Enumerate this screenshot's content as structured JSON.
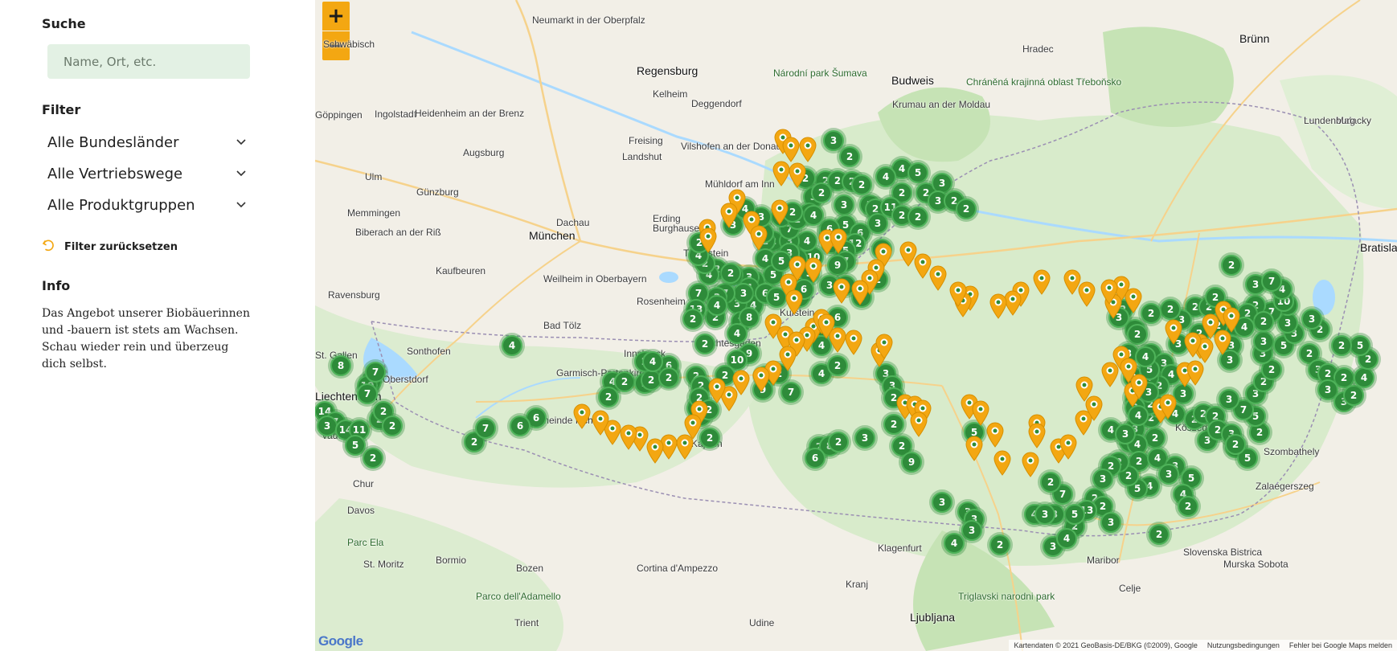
{
  "sidebar": {
    "search": {
      "heading": "Suche",
      "placeholder": "Name, Ort, etc."
    },
    "filter": {
      "heading": "Filter",
      "selects": [
        {
          "label": "Alle Bundesländer"
        },
        {
          "label": "Alle Vertriebswege"
        },
        {
          "label": "Alle Produktgruppen"
        }
      ],
      "reset_label": "Filter zurücksetzen"
    },
    "info": {
      "heading": "Info",
      "text": "Das Angebot unserer Biobäuerinnen und -bauern ist stets am Wachsen. Schau wieder rein und überzeug dich selbst."
    }
  },
  "map": {
    "zoom_in": "+",
    "zoom_out": "−",
    "google_logo": "Google",
    "attribution": {
      "data": "Kartendaten © 2021 GeoBasis-DE/BKG (©2009), Google",
      "terms": "Nutzungsbedingungen",
      "report": "Fehler bei Google Maps melden"
    },
    "colors": {
      "cluster": "#2e8b3a",
      "pin": "#f3a712",
      "land": "#f2efe7",
      "forest": "#cfe8c2",
      "water": "#aadaff"
    },
    "places": [
      {
        "name": "Brünn",
        "kind": "city"
      },
      {
        "name": "Regensburg",
        "kind": "city"
      },
      {
        "name": "Ingolstadt",
        "kind": "town"
      },
      {
        "name": "Budweis",
        "kind": "city"
      },
      {
        "name": "Landshut",
        "kind": "town"
      },
      {
        "name": "München",
        "kind": "city"
      },
      {
        "name": "Augsburg",
        "kind": "town"
      },
      {
        "name": "Ulm",
        "kind": "town"
      },
      {
        "name": "Rosenheim",
        "kind": "town"
      },
      {
        "name": "Kaufbeuren",
        "kind": "town"
      },
      {
        "name": "Ravensburg",
        "kind": "town"
      },
      {
        "name": "Sonthofen",
        "kind": "town"
      },
      {
        "name": "Oberstdorf",
        "kind": "town"
      },
      {
        "name": "St. Gallen",
        "kind": "town"
      },
      {
        "name": "Liechtenstein",
        "kind": "city"
      },
      {
        "name": "Vaduz",
        "kind": "town"
      },
      {
        "name": "Chur",
        "kind": "town"
      },
      {
        "name": "Davos",
        "kind": "town"
      },
      {
        "name": "Parc Ela",
        "kind": "park"
      },
      {
        "name": "St. Moritz",
        "kind": "town"
      },
      {
        "name": "Bormio",
        "kind": "town"
      },
      {
        "name": "Parco dell'Adamello",
        "kind": "park"
      },
      {
        "name": "Bozen",
        "kind": "town"
      },
      {
        "name": "Cortina d'Ampezzo",
        "kind": "town"
      },
      {
        "name": "Trient",
        "kind": "town"
      },
      {
        "name": "Udine",
        "kind": "town"
      },
      {
        "name": "Ljubljana",
        "kind": "city"
      },
      {
        "name": "Klagenfurt",
        "kind": "town"
      },
      {
        "name": "Maribor",
        "kind": "town"
      },
      {
        "name": "Celje",
        "kind": "town"
      },
      {
        "name": "Kranj",
        "kind": "town"
      },
      {
        "name": "Triglavski narodni park",
        "kind": "park"
      },
      {
        "name": "Slovenska Bistrica",
        "kind": "town"
      },
      {
        "name": "Murska Sobota",
        "kind": "town"
      },
      {
        "name": "Zalaegerszeg",
        "kind": "town"
      },
      {
        "name": "Szombathely",
        "kind": "town"
      },
      {
        "name": "Kőszeg",
        "kind": "town"
      },
      {
        "name": "Bratislava",
        "kind": "city"
      },
      {
        "name": "Malacky",
        "kind": "town"
      },
      {
        "name": "Lundenburg",
        "kind": "town"
      },
      {
        "name": "Hradec",
        "kind": "town"
      },
      {
        "name": "Krumau an der Moldau",
        "kind": "town"
      },
      {
        "name": "Chráněná krajinná oblast Třeboňsko",
        "kind": "park"
      },
      {
        "name": "Národní park Šumava",
        "kind": "park"
      },
      {
        "name": "Deggendorf",
        "kind": "town"
      },
      {
        "name": "Vilshofen an der Donau",
        "kind": "town"
      },
      {
        "name": "Mühldorf am Inn",
        "kind": "town"
      },
      {
        "name": "Erding",
        "kind": "town"
      },
      {
        "name": "Dachau",
        "kind": "town"
      },
      {
        "name": "Freising",
        "kind": "town"
      },
      {
        "name": "Kelheim",
        "kind": "town"
      },
      {
        "name": "Neumarkt in der Oberpfalz",
        "kind": "town"
      },
      {
        "name": "Schwäbisch",
        "kind": "town"
      },
      {
        "name": "Göppingen",
        "kind": "town"
      },
      {
        "name": "Heidenheim an der Brenz",
        "kind": "town"
      },
      {
        "name": "Günzburg",
        "kind": "town"
      },
      {
        "name": "Memmingen",
        "kind": "town"
      },
      {
        "name": "Biberach an der Riß",
        "kind": "town"
      },
      {
        "name": "Weilheim in Oberbayern",
        "kind": "town"
      },
      {
        "name": "Bad Tölz",
        "kind": "town"
      },
      {
        "name": "Garmisch-Partenkirchen",
        "kind": "town"
      },
      {
        "name": "Innsbruck",
        "kind": "town"
      },
      {
        "name": "Kufstein",
        "kind": "town"
      },
      {
        "name": "Traunstein",
        "kind": "town"
      },
      {
        "name": "Burghausen",
        "kind": "town"
      },
      {
        "name": "Berchtesgaden",
        "kind": "town"
      },
      {
        "name": "Gemeinde Ischgl",
        "kind": "town"
      },
      {
        "name": "Kaprun",
        "kind": "town"
      }
    ],
    "clusters": [
      {
        "label": "3"
      },
      {
        "label": "2"
      },
      {
        "label": "2"
      },
      {
        "label": "2"
      },
      {
        "label": "3"
      },
      {
        "label": "2"
      },
      {
        "label": "2"
      },
      {
        "label": "2"
      },
      {
        "label": "3"
      },
      {
        "label": "2"
      },
      {
        "label": "4"
      },
      {
        "label": "5"
      },
      {
        "label": "4"
      },
      {
        "label": "2"
      },
      {
        "label": "2"
      },
      {
        "label": "2"
      },
      {
        "label": "3"
      },
      {
        "label": "3"
      },
      {
        "label": "2"
      },
      {
        "label": "2"
      },
      {
        "label": "4"
      },
      {
        "label": "5"
      },
      {
        "label": "6"
      },
      {
        "label": "3"
      },
      {
        "label": "12"
      },
      {
        "label": "5"
      },
      {
        "label": "7"
      },
      {
        "label": "10"
      },
      {
        "label": "2"
      },
      {
        "label": "4"
      },
      {
        "label": "2"
      },
      {
        "label": "3"
      },
      {
        "label": "7"
      },
      {
        "label": "3"
      },
      {
        "label": "9"
      },
      {
        "label": "2"
      },
      {
        "label": "3"
      },
      {
        "label": "11"
      },
      {
        "label": "2"
      },
      {
        "label": "2"
      },
      {
        "label": "3"
      },
      {
        "label": "2"
      },
      {
        "label": "3"
      },
      {
        "label": "6"
      },
      {
        "label": "2"
      },
      {
        "label": "4"
      },
      {
        "label": "4"
      },
      {
        "label": "2"
      },
      {
        "label": "4"
      },
      {
        "label": "2"
      },
      {
        "label": "3"
      },
      {
        "label": "3"
      },
      {
        "label": "3"
      },
      {
        "label": "6"
      },
      {
        "label": "2"
      },
      {
        "label": "4"
      },
      {
        "label": "5"
      },
      {
        "label": "2"
      },
      {
        "label": "3"
      },
      {
        "label": "5"
      },
      {
        "label": "4"
      },
      {
        "label": "4"
      },
      {
        "label": "3"
      },
      {
        "label": "3"
      },
      {
        "label": "7"
      },
      {
        "label": "2"
      },
      {
        "label": "2"
      },
      {
        "label": "4"
      },
      {
        "label": "7"
      },
      {
        "label": "13"
      },
      {
        "label": "6"
      },
      {
        "label": "5"
      },
      {
        "label": "5"
      },
      {
        "label": "8"
      },
      {
        "label": "6"
      },
      {
        "label": "2"
      },
      {
        "label": "2"
      },
      {
        "label": "4"
      },
      {
        "label": "2"
      },
      {
        "label": "4"
      },
      {
        "label": "2"
      },
      {
        "label": "3"
      },
      {
        "label": "5"
      },
      {
        "label": "3"
      },
      {
        "label": "2"
      },
      {
        "label": "4"
      },
      {
        "label": "2"
      },
      {
        "label": "3"
      },
      {
        "label": "4"
      },
      {
        "label": "7"
      },
      {
        "label": "8"
      },
      {
        "label": "4"
      },
      {
        "label": "2"
      },
      {
        "label": "9"
      },
      {
        "label": "10"
      },
      {
        "label": "2"
      },
      {
        "label": "2"
      },
      {
        "label": "2"
      },
      {
        "label": "4"
      },
      {
        "label": "2"
      },
      {
        "label": "2"
      },
      {
        "label": "2"
      },
      {
        "label": "4"
      },
      {
        "label": "2"
      },
      {
        "label": "2"
      },
      {
        "label": "2"
      },
      {
        "label": "6"
      },
      {
        "label": "8"
      },
      {
        "label": "11"
      },
      {
        "label": "10"
      },
      {
        "label": "7"
      },
      {
        "label": "7"
      },
      {
        "label": "14"
      },
      {
        "label": "7"
      },
      {
        "label": "3"
      },
      {
        "label": "14"
      },
      {
        "label": "11"
      },
      {
        "label": "5"
      },
      {
        "label": "2"
      },
      {
        "label": "2"
      },
      {
        "label": "2"
      },
      {
        "label": "2"
      },
      {
        "label": "6"
      },
      {
        "label": "2"
      },
      {
        "label": "7"
      },
      {
        "label": "4"
      },
      {
        "label": "6"
      },
      {
        "label": "2"
      },
      {
        "label": "2"
      },
      {
        "label": "4"
      },
      {
        "label": "2"
      },
      {
        "label": "2"
      },
      {
        "label": "2"
      },
      {
        "label": "2"
      },
      {
        "label": "2"
      },
      {
        "label": "2"
      },
      {
        "label": "9"
      },
      {
        "label": "7"
      },
      {
        "label": "2"
      },
      {
        "label": "8"
      },
      {
        "label": "6"
      },
      {
        "label": "2"
      },
      {
        "label": "3"
      },
      {
        "label": "3"
      },
      {
        "label": "3"
      },
      {
        "label": "2"
      },
      {
        "label": "2"
      },
      {
        "label": "2"
      },
      {
        "label": "9"
      },
      {
        "label": "5"
      },
      {
        "label": "3"
      },
      {
        "label": "3"
      },
      {
        "label": "3"
      },
      {
        "label": "3"
      },
      {
        "label": "4"
      },
      {
        "label": "2"
      },
      {
        "label": "3"
      },
      {
        "label": "4"
      },
      {
        "label": "2"
      },
      {
        "label": "2"
      },
      {
        "label": "2"
      },
      {
        "label": "3"
      },
      {
        "label": "3"
      },
      {
        "label": "4"
      },
      {
        "label": "2"
      },
      {
        "label": "4"
      },
      {
        "label": "3"
      },
      {
        "label": "5"
      },
      {
        "label": "4"
      },
      {
        "label": "2"
      },
      {
        "label": "2"
      },
      {
        "label": "3"
      },
      {
        "label": "4"
      },
      {
        "label": "5"
      },
      {
        "label": "2"
      },
      {
        "label": "2"
      },
      {
        "label": "2"
      },
      {
        "label": "3"
      },
      {
        "label": "2"
      },
      {
        "label": "2"
      },
      {
        "label": "3"
      },
      {
        "label": "13"
      },
      {
        "label": "2"
      },
      {
        "label": "5"
      },
      {
        "label": "4"
      },
      {
        "label": "3"
      },
      {
        "label": "7"
      },
      {
        "label": "3"
      },
      {
        "label": "2"
      },
      {
        "label": "4"
      },
      {
        "label": "3"
      },
      {
        "label": "2"
      },
      {
        "label": "2"
      },
      {
        "label": "3"
      },
      {
        "label": "4"
      },
      {
        "label": "2"
      },
      {
        "label": "2"
      },
      {
        "label": "3"
      },
      {
        "label": "9"
      },
      {
        "label": "5"
      },
      {
        "label": "2"
      },
      {
        "label": "5"
      },
      {
        "label": "7"
      },
      {
        "label": "3"
      },
      {
        "label": "2"
      },
      {
        "label": "2"
      },
      {
        "label": "3"
      },
      {
        "label": "2"
      },
      {
        "label": "3"
      },
      {
        "label": "2"
      },
      {
        "label": "2"
      },
      {
        "label": "3"
      },
      {
        "label": "3"
      },
      {
        "label": "5"
      },
      {
        "label": "2"
      },
      {
        "label": "3"
      },
      {
        "label": "2"
      },
      {
        "label": "2"
      },
      {
        "label": "3"
      },
      {
        "label": "3"
      },
      {
        "label": "2"
      },
      {
        "label": "4"
      },
      {
        "label": "2"
      },
      {
        "label": "5"
      },
      {
        "label": "2"
      },
      {
        "label": "2"
      },
      {
        "label": "3"
      },
      {
        "label": "3"
      },
      {
        "label": "3"
      },
      {
        "label": "2"
      },
      {
        "label": "7"
      },
      {
        "label": "2"
      },
      {
        "label": "3"
      },
      {
        "label": "4"
      },
      {
        "label": "3"
      },
      {
        "label": "2"
      },
      {
        "label": "2"
      },
      {
        "label": "3"
      },
      {
        "label": "2"
      },
      {
        "label": "2"
      },
      {
        "label": "2"
      },
      {
        "label": "2"
      },
      {
        "label": "3"
      },
      {
        "label": "2"
      },
      {
        "label": "3"
      },
      {
        "label": "2"
      },
      {
        "label": "3"
      },
      {
        "label": "4"
      },
      {
        "label": "2"
      },
      {
        "label": "3"
      },
      {
        "label": "4"
      },
      {
        "label": "3"
      },
      {
        "label": "2"
      },
      {
        "label": "4"
      },
      {
        "label": "5"
      },
      {
        "label": "4"
      },
      {
        "label": "3"
      },
      {
        "label": "2"
      },
      {
        "label": "2"
      },
      {
        "label": "2"
      },
      {
        "label": "2"
      },
      {
        "label": "3"
      },
      {
        "label": "2"
      },
      {
        "label": "2"
      },
      {
        "label": "4"
      },
      {
        "label": "3"
      },
      {
        "label": "3"
      },
      {
        "label": "10"
      },
      {
        "label": "4"
      },
      {
        "label": "7"
      }
    ],
    "pins_count_hint": "orange single-location markers",
    "pins": [
      {},
      {},
      {},
      {},
      {},
      {},
      {},
      {},
      {},
      {},
      {},
      {},
      {},
      {},
      {},
      {},
      {},
      {},
      {},
      {},
      {},
      {},
      {},
      {},
      {},
      {},
      {},
      {},
      {},
      {},
      {},
      {},
      {},
      {},
      {},
      {},
      {},
      {},
      {},
      {},
      {},
      {},
      {},
      {},
      {},
      {},
      {},
      {},
      {},
      {},
      {},
      {},
      {},
      {},
      {},
      {},
      {},
      {},
      {},
      {},
      {},
      {},
      {},
      {},
      {},
      {},
      {},
      {},
      {},
      {},
      {},
      {},
      {},
      {},
      {},
      {},
      {},
      {},
      {},
      {},
      {},
      {},
      {},
      {},
      {},
      {},
      {},
      {},
      {},
      {},
      {},
      {},
      {},
      {},
      {},
      {},
      {},
      {},
      {},
      {}
    ]
  }
}
